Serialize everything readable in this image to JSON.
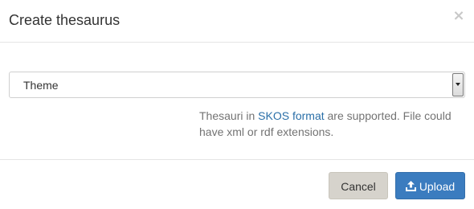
{
  "dialog": {
    "title": "Create thesaurus",
    "close_label": "×"
  },
  "form": {
    "select": {
      "selected": "Theme"
    },
    "help": {
      "prefix": "Thesauri in ",
      "link_text": "SKOS format",
      "suffix": " are supported. File could have xml or rdf extensions."
    }
  },
  "footer": {
    "cancel_label": "Cancel",
    "upload_label": "Upload",
    "upload_icon": "upload-icon"
  },
  "colors": {
    "link": "#2a6fa8",
    "primary": "#3b7cbf",
    "cancel_bg": "#d6d3cc"
  }
}
